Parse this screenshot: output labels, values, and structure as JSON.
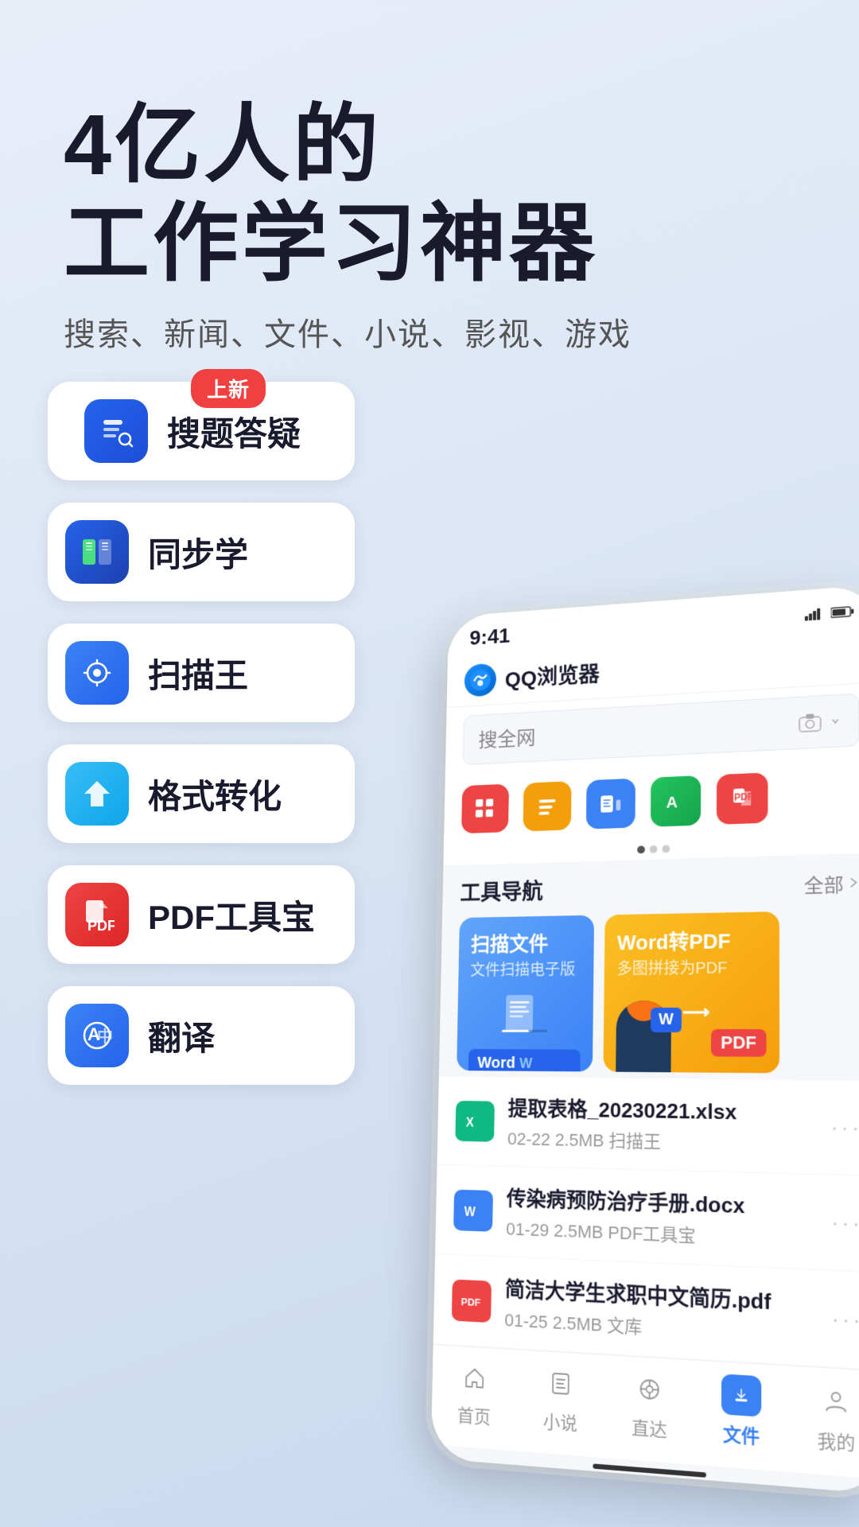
{
  "hero": {
    "title_line1": "4亿人的",
    "title_line2": "工作学习神器",
    "subtitle": "搜索、新闻、文件、小说、影视、游戏"
  },
  "features": [
    {
      "id": "search",
      "label": "搜题答疑",
      "icon_type": "search",
      "badge": "上新"
    },
    {
      "id": "sync",
      "label": "同步学",
      "icon_type": "sync",
      "badge": null
    },
    {
      "id": "scan",
      "label": "扫描王",
      "icon_type": "scan",
      "badge": null
    },
    {
      "id": "convert",
      "label": "格式转化",
      "icon_type": "convert",
      "badge": null
    },
    {
      "id": "pdf",
      "label": "PDF工具宝",
      "icon_type": "pdf",
      "badge": null
    },
    {
      "id": "translate",
      "label": "翻译",
      "icon_type": "translate",
      "badge": null
    }
  ],
  "phone": {
    "status_time": "9:41",
    "app_name": "QQ浏览器",
    "search_placeholder": "搜全网",
    "page_dots": 3,
    "tools_nav_title": "工具导航",
    "tools_nav_all": "全部",
    "tool_card1": {
      "title": "扫描文件",
      "sub": "文件扫描电子版"
    },
    "tool_card2": {
      "title": "Word转PDF",
      "sub": "多图拼接为PDF",
      "word_badge": "Word",
      "pdf_badge": "PDF"
    },
    "files": [
      {
        "name": "提取表格_20230221.xlsx",
        "meta": "02-22  2.5MB  扫描王",
        "icon_type": "excel"
      },
      {
        "name": "传染病预防治疗手册.docx",
        "meta": "01-29  2.5MB  PDF工具宝",
        "icon_type": "word"
      },
      {
        "name": "简洁大学生求职中文简历.pdf",
        "meta": "01-25  2.5MB  文库",
        "icon_type": "pdf"
      }
    ],
    "nav_items": [
      {
        "label": "首页",
        "active": false
      },
      {
        "label": "小说",
        "active": false
      },
      {
        "label": "直达",
        "active": false
      },
      {
        "label": "文件",
        "active": true
      },
      {
        "label": "我的",
        "active": false
      }
    ]
  }
}
